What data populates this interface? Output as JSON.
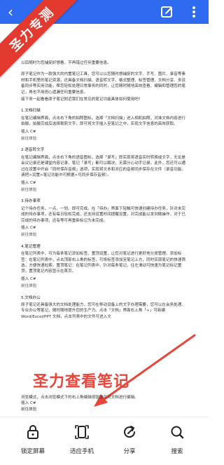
{
  "header": {
    "bg": "#2f6bf0"
  },
  "ribbon": {
    "text": "圣力专测",
    "color": "#e23a2f"
  },
  "doc": {
    "intro": [
      "以后随时为您捕捉好想看，不再错过任何重要信息。",
      "原子笔记作为一款强大的内置笔记工具，您可以以您随时想捕捉的文字、手写、图片、录音等素材和手机里的笔记资源，还具备文档扫描、语音转文字、格式整理、标签管理、文档分享、多设备同步等实用功能，帮您轻松处理日常事务的同时，让您随时随地高效查看、编辑和管理您的笔记，再也不用担心遗漏任何重要信息。",
      "接下来一起看看原子笔记附近我们在常见的笔记功能具体如何使用吧！"
    ],
    "sections": [
      {
        "title": "1.文档扫描",
        "body": "在笔记编辑界面，点击右下角的拍照图标，选择「文档扫描」进入相机拍照，对准文档内容进行拍摄，拍摄完成后选择裁剪文字，即可将文字插入至笔记之中，实现文字信息的高效获取。",
        "insert": "插入 C#",
        "link": "前往体验"
      },
      {
        "title": "2.语音转文字",
        "body": "在笔记编辑界面，点击右下角的语音图标，选择「录写」即实现将语音实时转换成文字，无论是会议记录还是课堂内容记录，笔记「录写」都可以解决，无需分心动手记录。此外，您还可以通过在设置中开启「同时保存音频」选项，实现将文本和对应的音频同步保存在文件（录音功能，请把>设置>笔记功能中可根据>可同步保存音频）。",
        "insert": "插入 C#",
        "link": "前往体验"
      },
      {
        "title": "3.待办事项",
        "body": "记个待办任务，一点、一划、即可完成。在「待办」界面下轻触可快速创建待办任务，针对未完成的待办事项，还有每日轻松完成，还支持设置时间提醒设置，对完成能以发到微操作，对于已完成的待办事项，还有等可再重新标记为未完成。",
        "insert": "插入 C#",
        "link": "前往体验"
      },
      {
        "title": "4.笔记管理",
        "body": "在笔记列表中，可为每条笔记添加标签、置顶设置，让您对笔记进行更好地分类管理。添加标签：在笔记列表中，点击顶部右上角的标签，可将标签添加至笔记上方，同时实现笔记的快速筛选，方便快速检索。置顶笔记：在笔记列表中，针对每条笔记，往左滑动可快速为笔记标记置顶，置顶笔记内容显示在首页。",
        "insert": "插入 C#",
        "link": "前往体验"
      },
      {
        "title": "5.文档办公",
        "body": "原子笔记还具备强大的文档处理能力，您可在移动设备上的文字办理需要，您可以在会务处理、专业办公等笔记，随时随地提升您的生产力。点击「文档」界面右上角「+」可新建 Word/Excel/PPT 文档，点击列表中的文件可进入文",
        "insert": "",
        "link": ""
      }
    ],
    "footer": {
      "body": "浏览模式，点击浏览模式下的右上角编辑按钮即可对文档进行编辑。",
      "insert": "插入 C#",
      "link": "前往体验"
    }
  },
  "overlay": {
    "caption": "圣力查看笔记",
    "color": "#e9463b"
  },
  "toolbar": {
    "items": [
      {
        "label": "锁定屏幕",
        "icon": "lock-icon"
      },
      {
        "label": "适应手机",
        "icon": "fit-phone-icon"
      },
      {
        "label": "分享",
        "icon": "share-icon"
      },
      {
        "label": "搜索",
        "icon": "search-icon"
      }
    ]
  }
}
